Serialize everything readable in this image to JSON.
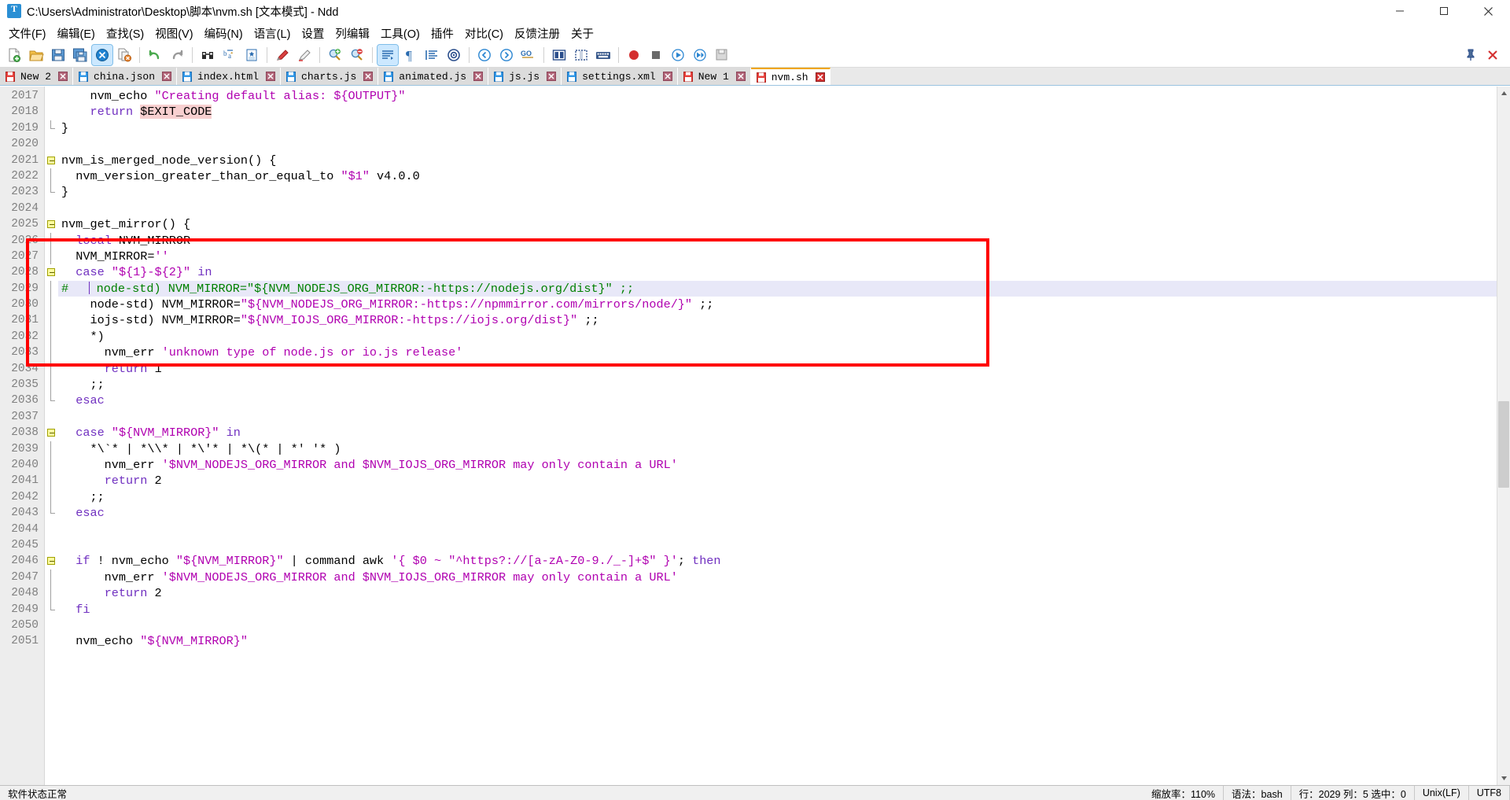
{
  "window": {
    "title": "C:\\Users\\Administrator\\Desktop\\脚本\\nvm.sh [文本模式] - Ndd",
    "app_icon": "text-document-icon",
    "minimize": "minimize-button",
    "maximize": "maximize-button",
    "close": "close-button"
  },
  "menubar": {
    "items": [
      {
        "label": "文件(F)"
      },
      {
        "label": "编辑(E)"
      },
      {
        "label": "查找(S)"
      },
      {
        "label": "视图(V)"
      },
      {
        "label": "编码(N)"
      },
      {
        "label": "语言(L)"
      },
      {
        "label": "设置"
      },
      {
        "label": "列编辑"
      },
      {
        "label": "工具(O)"
      },
      {
        "label": "插件"
      },
      {
        "label": "对比(C)"
      },
      {
        "label": "反馈注册"
      },
      {
        "label": "关于"
      }
    ]
  },
  "toolbar": {
    "groups": [
      [
        "new-file-icon",
        "open-file-icon",
        "save-icon",
        "save-all-icon",
        "close-file-icon",
        "close-all-icon"
      ],
      [
        "undo-icon",
        "redo-icon"
      ],
      [
        "find-icon",
        "replace-icon",
        "bookmark-icon"
      ],
      [
        "highlight-marker-icon",
        "clear-marker-icon"
      ],
      [
        "zoom-in-icon",
        "zoom-out-icon"
      ],
      [
        "word-wrap-icon",
        "show-pilcrow-icon",
        "show-indent-guide-icon",
        "record-macro-icon"
      ],
      [
        "nav-back-icon",
        "nav-forward-icon",
        "goto-line-icon"
      ],
      [
        "split-view-icon",
        "column-edit-icon",
        "keyboard-icon"
      ],
      [
        "record-icon",
        "stop-icon",
        "play-icon",
        "play-multi-icon",
        "save-macro-icon"
      ]
    ],
    "active_tool": "close-file-icon",
    "active_tool2": "word-wrap-icon",
    "right": [
      "pin-window-icon",
      "close-panel-icon"
    ]
  },
  "tabs": {
    "items": [
      {
        "label": "New 2",
        "icon": "unsaved-doc-icon",
        "modified": true,
        "active": false
      },
      {
        "label": "china.json",
        "icon": "saved-doc-icon",
        "modified": false,
        "active": false
      },
      {
        "label": "index.html",
        "icon": "saved-doc-icon",
        "modified": false,
        "active": false
      },
      {
        "label": "charts.js",
        "icon": "saved-doc-icon",
        "modified": false,
        "active": false
      },
      {
        "label": "animated.js",
        "icon": "saved-doc-icon",
        "modified": false,
        "active": false
      },
      {
        "label": "js.js",
        "icon": "saved-doc-icon",
        "modified": false,
        "active": false
      },
      {
        "label": "settings.xml",
        "icon": "saved-doc-icon",
        "modified": false,
        "active": false
      },
      {
        "label": "New 1",
        "icon": "unsaved-doc-icon",
        "modified": true,
        "active": false
      },
      {
        "label": "nvm.sh",
        "icon": "unsaved-doc-icon",
        "modified": true,
        "active": true
      }
    ],
    "close_icon": "tab-close-icon"
  },
  "editor": {
    "first_line_number": 2017,
    "caret_line": 2029,
    "highlight_line": 2029,
    "lines": [
      {
        "n": 2017,
        "fold": "",
        "tokens": [
          {
            "t": "plain",
            "v": "    nvm_echo "
          },
          {
            "t": "str",
            "v": "\"Creating default alias: ${OUTPUT}\""
          }
        ]
      },
      {
        "n": 2018,
        "fold": "",
        "tokens": [
          {
            "t": "plain",
            "v": "    "
          },
          {
            "t": "kw",
            "v": "return"
          },
          {
            "t": "plain",
            "v": " "
          },
          {
            "t": "var",
            "v": "$EXIT_CODE"
          }
        ]
      },
      {
        "n": 2019,
        "fold": "end",
        "tokens": [
          {
            "t": "plain",
            "v": "}"
          }
        ]
      },
      {
        "n": 2020,
        "fold": "",
        "tokens": [
          {
            "t": "plain",
            "v": ""
          }
        ]
      },
      {
        "n": 2021,
        "fold": "open",
        "tokens": [
          {
            "t": "plain",
            "v": "nvm_is_merged_node_version() {"
          }
        ]
      },
      {
        "n": 2022,
        "fold": "bar",
        "tokens": [
          {
            "t": "plain",
            "v": "  nvm_version_greater_than_or_equal_to "
          },
          {
            "t": "str",
            "v": "\"$1\""
          },
          {
            "t": "plain",
            "v": " v4.0.0"
          }
        ]
      },
      {
        "n": 2023,
        "fold": "end",
        "tokens": [
          {
            "t": "plain",
            "v": "}"
          }
        ]
      },
      {
        "n": 2024,
        "fold": "",
        "tokens": [
          {
            "t": "plain",
            "v": ""
          }
        ]
      },
      {
        "n": 2025,
        "fold": "open",
        "tokens": [
          {
            "t": "plain",
            "v": "nvm_get_mirror() {"
          }
        ]
      },
      {
        "n": 2026,
        "fold": "bar",
        "tokens": [
          {
            "t": "plain",
            "v": "  "
          },
          {
            "t": "kw",
            "v": "local"
          },
          {
            "t": "plain",
            "v": " NVM_MIRROR"
          }
        ]
      },
      {
        "n": 2027,
        "fold": "bar",
        "tokens": [
          {
            "t": "plain",
            "v": "  NVM_MIRROR="
          },
          {
            "t": "str",
            "v": "''"
          }
        ]
      },
      {
        "n": 2028,
        "fold": "open",
        "tokens": [
          {
            "t": "plain",
            "v": "  "
          },
          {
            "t": "kw",
            "v": "case"
          },
          {
            "t": "plain",
            "v": " "
          },
          {
            "t": "str",
            "v": "\"${1}-${2}\""
          },
          {
            "t": "plain",
            "v": " "
          },
          {
            "t": "kw",
            "v": "in"
          }
        ]
      },
      {
        "n": 2029,
        "fold": "bar",
        "highlight": true,
        "caret_after": 4,
        "tokens": [
          {
            "t": "cmt",
            "v": "#    node-std) NVM_MIRROR=\"${NVM_NODEJS_ORG_MIRROR:-https://nodejs.org/dist}\" ;;"
          }
        ]
      },
      {
        "n": 2030,
        "fold": "bar",
        "tokens": [
          {
            "t": "plain",
            "v": "    node-std) NVM_MIRROR="
          },
          {
            "t": "str",
            "v": "\"${NVM_NODEJS_ORG_MIRROR:-https://npmmirror.com/mirrors/node/}\""
          },
          {
            "t": "plain",
            "v": " ;;"
          }
        ]
      },
      {
        "n": 2031,
        "fold": "bar",
        "tokens": [
          {
            "t": "plain",
            "v": "    iojs-std) NVM_MIRROR="
          },
          {
            "t": "str",
            "v": "\"${NVM_IOJS_ORG_MIRROR:-https://iojs.org/dist}\""
          },
          {
            "t": "plain",
            "v": " ;;"
          }
        ]
      },
      {
        "n": 2032,
        "fold": "bar",
        "tokens": [
          {
            "t": "plain",
            "v": "    *)"
          }
        ]
      },
      {
        "n": 2033,
        "fold": "bar",
        "tokens": [
          {
            "t": "plain",
            "v": "      nvm_err "
          },
          {
            "t": "str",
            "v": "'unknown type of node.js or io.js release'"
          }
        ]
      },
      {
        "n": 2034,
        "fold": "bar",
        "tokens": [
          {
            "t": "plain",
            "v": "      "
          },
          {
            "t": "kw",
            "v": "return"
          },
          {
            "t": "plain",
            "v": " 1"
          }
        ]
      },
      {
        "n": 2035,
        "fold": "bar",
        "tokens": [
          {
            "t": "plain",
            "v": "    ;;"
          }
        ]
      },
      {
        "n": 2036,
        "fold": "end",
        "tokens": [
          {
            "t": "plain",
            "v": "  "
          },
          {
            "t": "kw",
            "v": "esac"
          }
        ]
      },
      {
        "n": 2037,
        "fold": "",
        "tokens": [
          {
            "t": "plain",
            "v": ""
          }
        ]
      },
      {
        "n": 2038,
        "fold": "open",
        "tokens": [
          {
            "t": "plain",
            "v": "  "
          },
          {
            "t": "kw",
            "v": "case"
          },
          {
            "t": "plain",
            "v": " "
          },
          {
            "t": "str",
            "v": "\"${NVM_MIRROR}\""
          },
          {
            "t": "plain",
            "v": " "
          },
          {
            "t": "kw",
            "v": "in"
          }
        ]
      },
      {
        "n": 2039,
        "fold": "bar",
        "tokens": [
          {
            "t": "plain",
            "v": "    *\\`* | *\\\\* | *\\'* | *\\(* | *' '* )"
          }
        ]
      },
      {
        "n": 2040,
        "fold": "bar",
        "tokens": [
          {
            "t": "plain",
            "v": "      nvm_err "
          },
          {
            "t": "str",
            "v": "'$NVM_NODEJS_ORG_MIRROR and $NVM_IOJS_ORG_MIRROR may only contain a URL'"
          }
        ]
      },
      {
        "n": 2041,
        "fold": "bar",
        "tokens": [
          {
            "t": "plain",
            "v": "      "
          },
          {
            "t": "kw",
            "v": "return"
          },
          {
            "t": "plain",
            "v": " 2"
          }
        ]
      },
      {
        "n": 2042,
        "fold": "bar",
        "tokens": [
          {
            "t": "plain",
            "v": "    ;;"
          }
        ]
      },
      {
        "n": 2043,
        "fold": "end",
        "tokens": [
          {
            "t": "plain",
            "v": "  "
          },
          {
            "t": "kw",
            "v": "esac"
          }
        ]
      },
      {
        "n": 2044,
        "fold": "",
        "tokens": [
          {
            "t": "plain",
            "v": ""
          }
        ]
      },
      {
        "n": 2045,
        "fold": "",
        "tokens": [
          {
            "t": "plain",
            "v": ""
          }
        ]
      },
      {
        "n": 2046,
        "fold": "open",
        "tokens": [
          {
            "t": "plain",
            "v": "  "
          },
          {
            "t": "kw",
            "v": "if"
          },
          {
            "t": "plain",
            "v": " ! nvm_echo "
          },
          {
            "t": "str",
            "v": "\"${NVM_MIRROR}\""
          },
          {
            "t": "plain",
            "v": " | command awk "
          },
          {
            "t": "str",
            "v": "'{ $0 ~ \"^https?://[a-zA-Z0-9./_-]+$\" }'"
          },
          {
            "t": "plain",
            "v": "; "
          },
          {
            "t": "kw",
            "v": "then"
          }
        ]
      },
      {
        "n": 2047,
        "fold": "bar",
        "tokens": [
          {
            "t": "plain",
            "v": "      nvm_err "
          },
          {
            "t": "str",
            "v": "'$NVM_NODEJS_ORG_MIRROR and $NVM_IOJS_ORG_MIRROR may only contain a URL'"
          }
        ]
      },
      {
        "n": 2048,
        "fold": "bar",
        "tokens": [
          {
            "t": "plain",
            "v": "      "
          },
          {
            "t": "kw",
            "v": "return"
          },
          {
            "t": "plain",
            "v": " 2"
          }
        ]
      },
      {
        "n": 2049,
        "fold": "end",
        "tokens": [
          {
            "t": "plain",
            "v": "  "
          },
          {
            "t": "kw",
            "v": "fi"
          }
        ]
      },
      {
        "n": 2050,
        "fold": "",
        "tokens": [
          {
            "t": "plain",
            "v": ""
          }
        ]
      },
      {
        "n": 2051,
        "fold": "",
        "tokens": [
          {
            "t": "plain",
            "v": "  nvm_echo "
          },
          {
            "t": "str",
            "v": "\"${NVM_MIRROR}\""
          }
        ]
      }
    ]
  },
  "annotation": {
    "name": "red-highlight-rectangle",
    "color": "#ff0000"
  },
  "statusbar": {
    "left": "软件状态正常",
    "zoom": "缩放率：110%",
    "syntax": "语法：bash",
    "position": "行：2029 列：5 选中：0",
    "eol": "Unix(LF)",
    "encoding": "UTF8"
  },
  "colors": {
    "accent": "#0078d7",
    "tab_active_top": "#f0a500",
    "comment": "#008000",
    "string": "#b000b0",
    "keyword": "#7030c0",
    "annotation": "#ff0000",
    "highlight_line": "#e8e8f8"
  }
}
